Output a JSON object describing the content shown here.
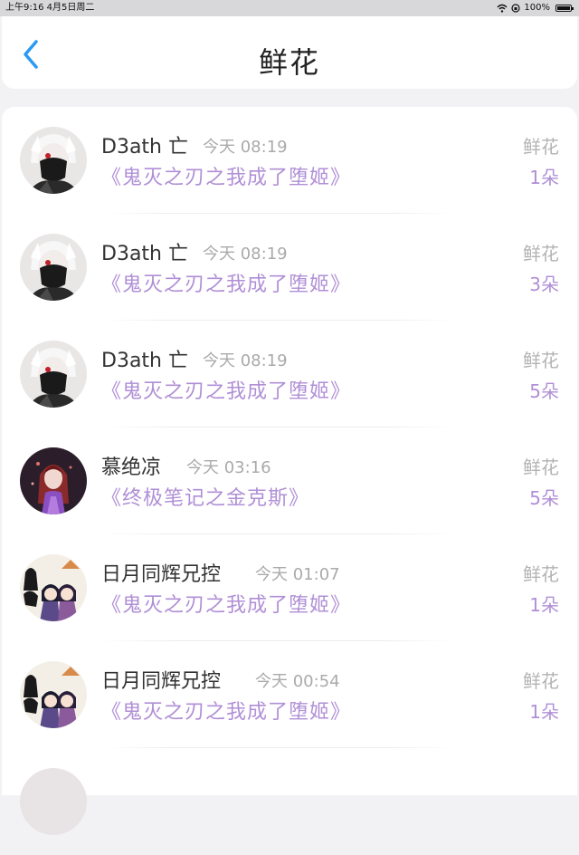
{
  "status_bar": {
    "time_date": "上午9:16   4月5日周二",
    "battery": "100%"
  },
  "nav": {
    "title": "鲜花"
  },
  "items": [
    {
      "user": "D3ath 亡",
      "time": "今天 08:19",
      "book": "《鬼灭之刃之我成了堕姬》",
      "gift": "鲜花",
      "count": "1朵",
      "avatar": "dark-masked-avatar"
    },
    {
      "user": "D3ath 亡",
      "time": "今天 08:19",
      "book": "《鬼灭之刃之我成了堕姬》",
      "gift": "鲜花",
      "count": "3朵",
      "avatar": "dark-masked-avatar"
    },
    {
      "user": "D3ath 亡",
      "time": "今天 08:19",
      "book": "《鬼灭之刃之我成了堕姬》",
      "gift": "鲜花",
      "count": "5朵",
      "avatar": "dark-masked-avatar"
    },
    {
      "user": "慕绝凉",
      "time": "今天 03:16",
      "book": "《终极笔记之金克斯》",
      "gift": "鲜花",
      "count": "5朵",
      "avatar": "red-hair-girl-avatar"
    },
    {
      "user": "日月同辉兄控",
      "time": "今天 01:07",
      "book": "《鬼灭之刃之我成了堕姬》",
      "gift": "鲜花",
      "count": "1朵",
      "avatar": "anime-duo-avatar"
    },
    {
      "user": "日月同辉兄控",
      "time": "今天 00:54",
      "book": "《鬼灭之刃之我成了堕姬》",
      "gift": "鲜花",
      "count": "1朵",
      "avatar": "anime-duo-avatar"
    }
  ]
}
